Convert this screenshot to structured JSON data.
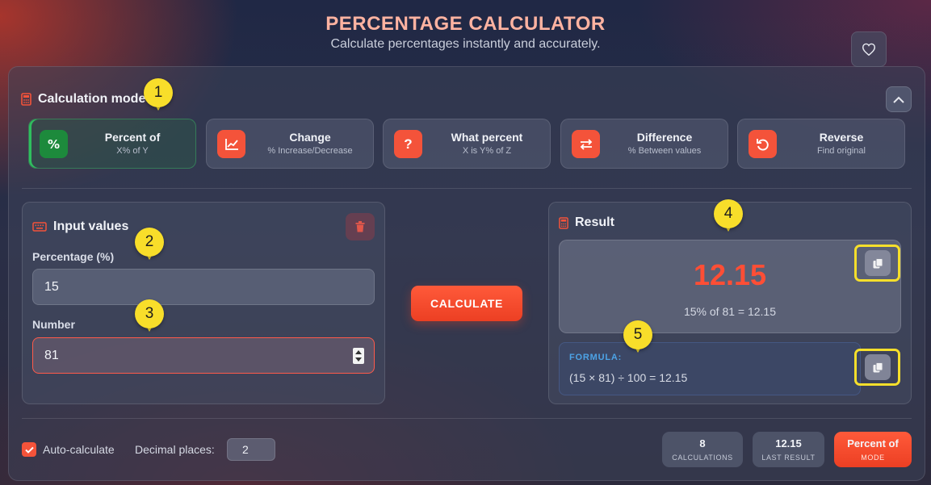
{
  "header": {
    "title": "PERCENTAGE CALCULATOR",
    "subtitle": "Calculate percentages instantly and accurately."
  },
  "mode_section": {
    "title": "Calculation mode",
    "modes": [
      {
        "title": "Percent of",
        "subtitle": "X% of Y",
        "icon": "percent-icon",
        "active": true
      },
      {
        "title": "Change",
        "subtitle": "% Increase/Decrease",
        "icon": "trend-chart-icon",
        "active": false
      },
      {
        "title": "What percent",
        "subtitle": "X is Y% of Z",
        "icon": "question-icon",
        "active": false
      },
      {
        "title": "Difference",
        "subtitle": "% Between values",
        "icon": "swap-arrows-icon",
        "active": false
      },
      {
        "title": "Reverse",
        "subtitle": "Find original",
        "icon": "undo-icon",
        "active": false
      }
    ]
  },
  "input_section": {
    "title": "Input values",
    "percentage_label": "Percentage (%)",
    "percentage_value": "15",
    "number_label": "Number",
    "number_value": "81"
  },
  "calculate_label": "CALCULATE",
  "result_section": {
    "title": "Result",
    "value": "12.15",
    "equation": "15% of 81 = 12.15",
    "formula_label": "FORMULA:",
    "formula": "(15 × 81) ÷ 100 = 12.15"
  },
  "footer": {
    "auto_calc_label": "Auto-calculate",
    "auto_calc_checked": true,
    "decimal_label": "Decimal places:",
    "decimal_value": "2",
    "stats": [
      {
        "value": "8",
        "label": "CALCULATIONS"
      },
      {
        "value": "12.15",
        "label": "LAST RESULT"
      },
      {
        "value": "Percent of",
        "label": "MODE"
      }
    ]
  },
  "markers": [
    "1",
    "2",
    "3",
    "4",
    "5"
  ],
  "colors": {
    "accent": "#f4533a",
    "active_mode": "#1d8a3c",
    "title": "#ffb3a1",
    "formula": "#4da3e6",
    "highlight": "#f6df2b"
  }
}
